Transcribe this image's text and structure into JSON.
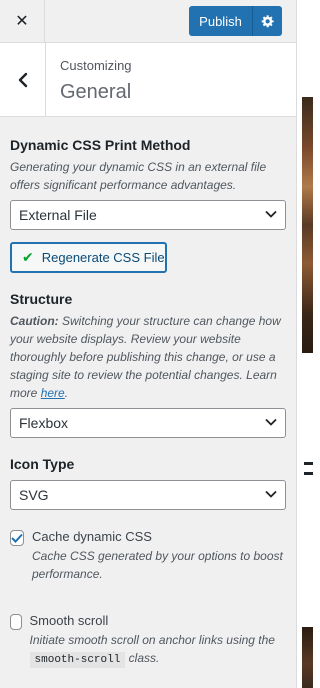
{
  "topbar": {
    "close_icon": "close-icon",
    "publish_label": "Publish",
    "settings_icon": "gear-icon",
    "accent": "#2271b1"
  },
  "section": {
    "back_icon": "chevron-left-icon",
    "subtitle": "Customizing",
    "title": "General"
  },
  "css_print": {
    "label": "Dynamic CSS Print Method",
    "description": "Generating your dynamic CSS in an external file offers significant performance advantages.",
    "selected": "External File",
    "regen_label": "Regenerate CSS File"
  },
  "structure": {
    "label": "Structure",
    "caution_label": "Caution:",
    "caution_text": " Switching your structure can change how your website displays. Review your website thoroughly before publishing this change, or use a staging site to review the potential changes. Learn more ",
    "link_text": "here",
    "link_suffix": ".",
    "selected": "Flexbox"
  },
  "icon_type": {
    "label": "Icon Type",
    "selected": "SVG"
  },
  "cache_css": {
    "checked": true,
    "label": "Cache dynamic CSS",
    "description": "Cache CSS generated by your options to boost performance."
  },
  "smooth_scroll": {
    "checked": false,
    "label": "Smooth scroll",
    "description_prefix": "Initiate smooth scroll on anchor links using the ",
    "code": "smooth-scroll",
    "description_suffix": " class."
  }
}
